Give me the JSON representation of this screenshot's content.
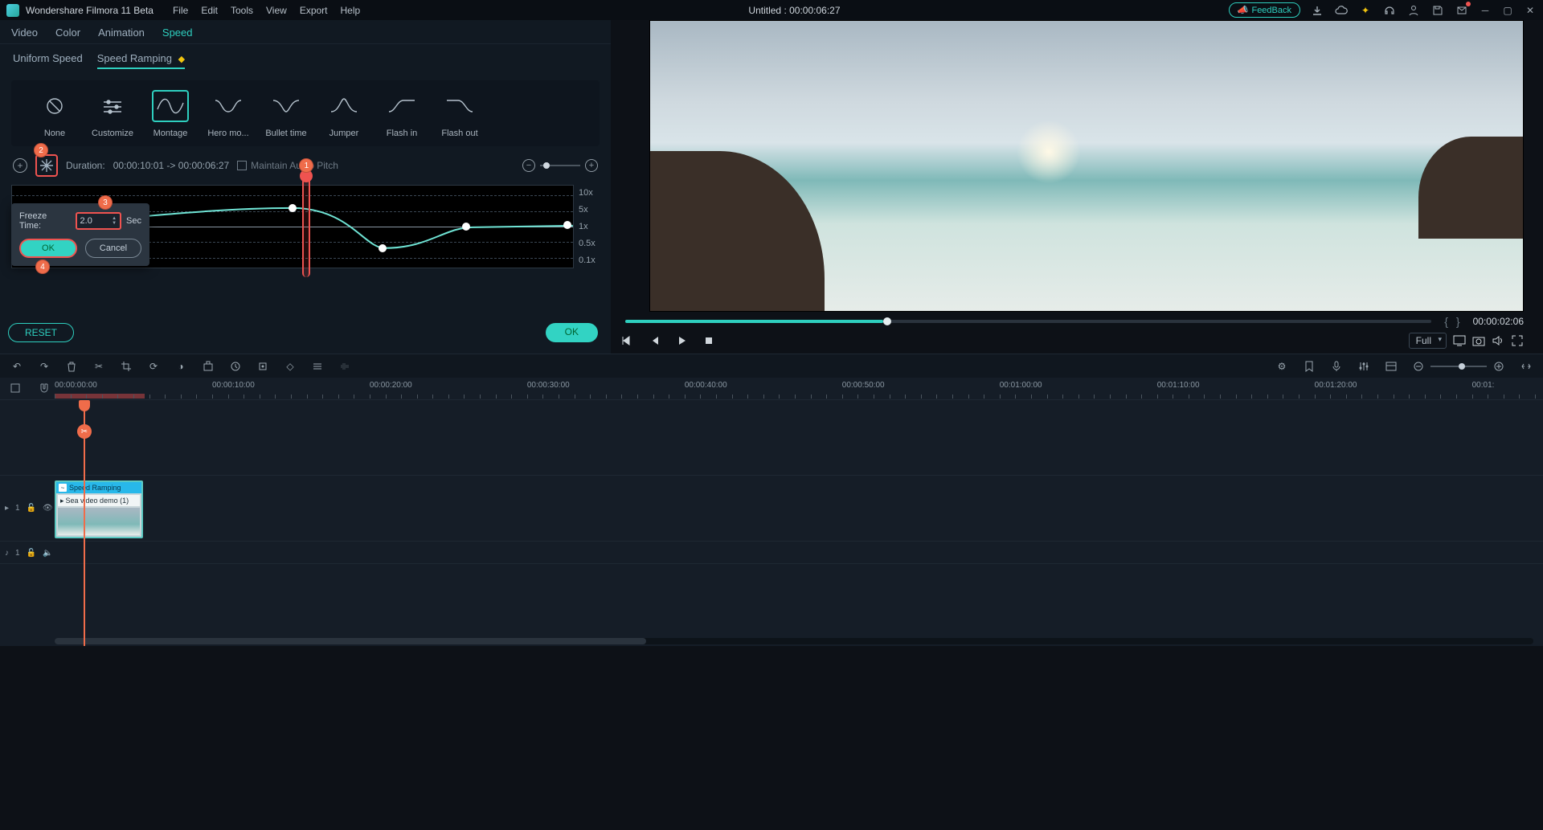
{
  "app": {
    "name": "Wondershare Filmora 11 Beta",
    "project": "Untitled : 00:00:06:27"
  },
  "menu": [
    "File",
    "Edit",
    "Tools",
    "View",
    "Export",
    "Help"
  ],
  "feedback": "FeedBack",
  "panel_tabs": {
    "items": [
      "Video",
      "Color",
      "Animation",
      "Speed"
    ],
    "active": "Speed"
  },
  "speed_tabs": {
    "uniform": "Uniform Speed",
    "ramping": "Speed Ramping"
  },
  "presets": [
    "None",
    "Customize",
    "Montage",
    "Hero mo...",
    "Bullet time",
    "Jumper",
    "Flash in",
    "Flash out"
  ],
  "preset_active": "Montage",
  "duration": {
    "label": "Duration:",
    "value": "00:00:10:01 -> 00:00:06:27"
  },
  "maintain_pitch": "Maintain Audio Pitch",
  "yaxis": [
    "10x",
    "5x",
    "1x",
    "0.5x",
    "0.1x"
  ],
  "freeze": {
    "label": "Freeze Time:",
    "value": "2.0",
    "unit": "Sec",
    "ok": "OK",
    "cancel": "Cancel"
  },
  "actions": {
    "reset": "RESET",
    "ok": "OK"
  },
  "preview": {
    "time": "00:00:02:06",
    "mode": "Full"
  },
  "timeline": {
    "marks": [
      "00:00:00:00",
      "00:00:10:00",
      "00:00:20:00",
      "00:00:30:00",
      "00:00:40:00",
      "00:00:50:00",
      "00:01:00:00",
      "00:01:10:00",
      "00:01:20:00",
      "00:01:"
    ],
    "clip_tag": "Speed Ramping",
    "clip_name": "Sea video demo (1)",
    "video_track": "1",
    "audio_track": "1"
  },
  "annotations": {
    "b1": "1",
    "b2": "2",
    "b3": "3",
    "b4": "4"
  }
}
